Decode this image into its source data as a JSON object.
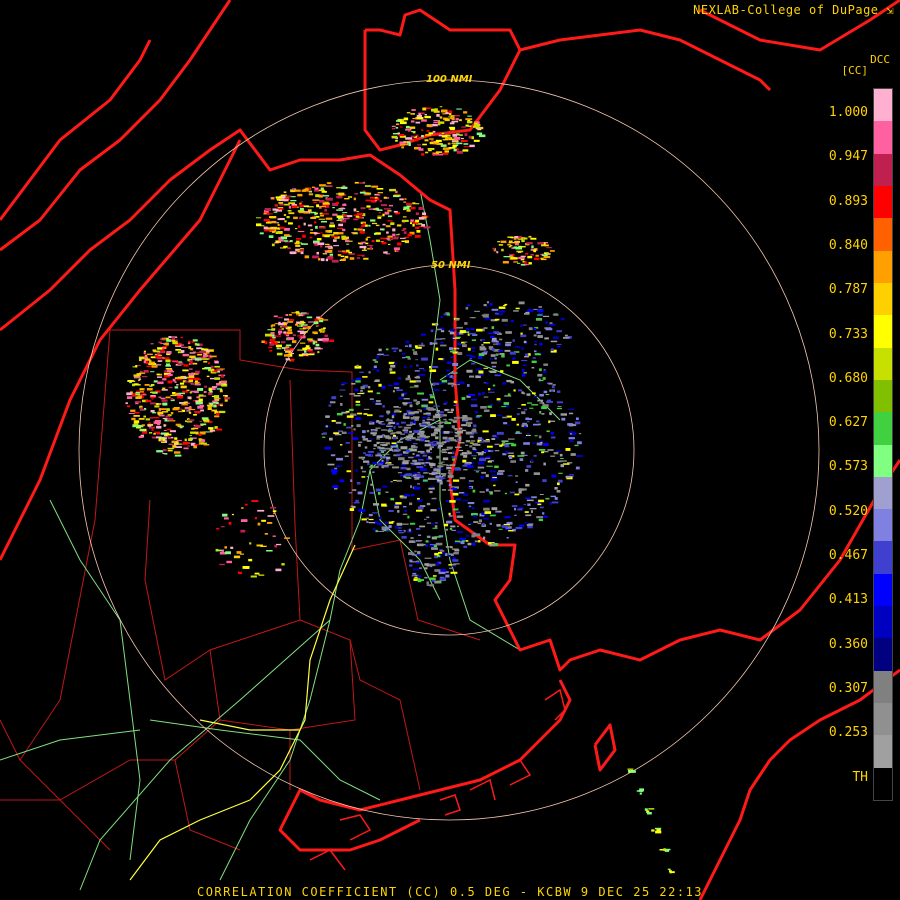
{
  "credit": "NEXLAB-College of DuPage",
  "logo_icon": "nexlab-logo-icon",
  "legend": {
    "unit_abbr": "DCC",
    "unit": "[CC]",
    "ticks": [
      "1.000",
      "0.947",
      "0.893",
      "0.840",
      "0.787",
      "0.733",
      "0.680",
      "0.627",
      "0.573",
      "0.520",
      "0.467",
      "0.413",
      "0.360",
      "0.307",
      "0.253",
      "TH"
    ],
    "colors": [
      "#ffb0d0",
      "#ff60a0",
      "#c02050",
      "#ff0000",
      "#ff6000",
      "#ffa000",
      "#ffd000",
      "#ffff00",
      "#c8e000",
      "#80c000",
      "#40d040",
      "#80ff80",
      "#a0a0d0",
      "#8080e0",
      "#4040d0",
      "#0000ff",
      "#0000c0",
      "#000080",
      "#808080",
      "#909090",
      "#a0a0a0",
      "#000000"
    ]
  },
  "range_rings": [
    "100 NMI",
    "50 NMI"
  ],
  "caption": "CORRELATION COEFFICIENT (CC) 0.5 DEG - KCBW 9 DEC 25 22:13",
  "colors": {
    "border": "#ff1a1a",
    "county": "#c01818",
    "highway": "#ffff40",
    "road": "#80e080",
    "ring": "#f4c8b0",
    "text": "#ffd400"
  }
}
